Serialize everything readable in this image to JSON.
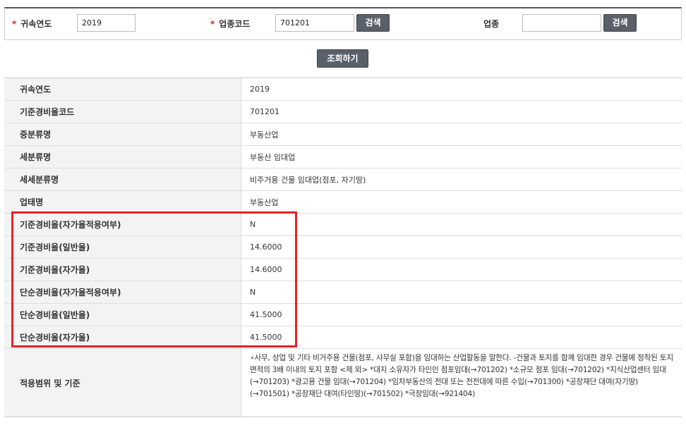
{
  "search": {
    "year_label": "귀속연도",
    "year_value": "2019",
    "code_label": "업종코드",
    "code_value": "701201",
    "code_search_button": "검색",
    "industry_label": "업종",
    "industry_value": "",
    "industry_search_button": "검색",
    "required_mark": "*",
    "query_button": "조회하기"
  },
  "result_rows": [
    {
      "label": "귀속연도",
      "value": "2019"
    },
    {
      "label": "기준경비율코드",
      "value": "701201"
    },
    {
      "label": "중분류명",
      "value": "부동산업"
    },
    {
      "label": "세분류명",
      "value": "부동산 임대업"
    },
    {
      "label": "세세분류명",
      "value": "비주거용 건물 임대업(점포, 자기땅)"
    },
    {
      "label": "업태명",
      "value": "부동산업"
    },
    {
      "label": "기준경비율(자가율적용여부)",
      "value": "N"
    },
    {
      "label": "기준경비율(일반율)",
      "value": "14.6000"
    },
    {
      "label": "기준경비율(자가율)",
      "value": "14.6000"
    },
    {
      "label": "단순경비율(자가율적용여부)",
      "value": "N"
    },
    {
      "label": "단순경비율(일반율)",
      "value": "41.5000"
    },
    {
      "label": "단순경비율(자가율)",
      "value": "41.5000"
    }
  ],
  "scope": {
    "label": "적용범위 및 기준",
    "value": "∘사무, 상업 및 기타 비거주용 건물(점포, 사무실 포함)을 임대하는 산업활동을 말한다. -건물과 토지를 함께 임대한 경우 건물에 정착된 토지면적의 3배 이내의 토지 포함 <제 외> *대지 소유자가 타인인 점포임대(→701202) *소규모 점포 임대(→701202) *지식산업센터 임대(→701203) *광고용 건물 임대(→701204) *임차부동산의 전대 또는 전전대에 따른 수입(→701300) *공장재단 대여(자기땅)(→701501) *공장재단 대여(타인땅)(→701502) *극장임대(→921404)"
  },
  "colors": {
    "highlight": "#e52323",
    "button": "#5a6069",
    "label_bg": "#f3f3f3",
    "required": "#d32a2a"
  }
}
